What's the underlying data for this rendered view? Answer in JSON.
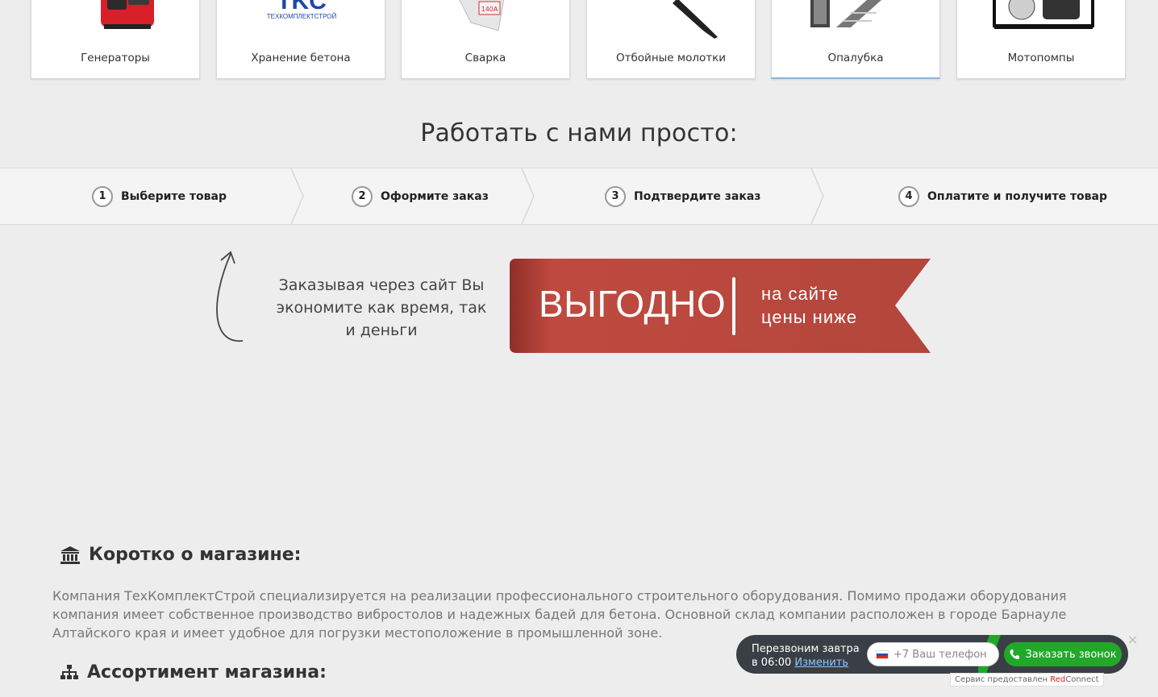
{
  "categories": [
    {
      "label": "Генераторы"
    },
    {
      "label": "Хранение бетона",
      "logo_text": "TKC",
      "logo_sub": "ТЕХКОМПЛЕКТСТРОЙ"
    },
    {
      "label": "Сварка",
      "tag": "140A"
    },
    {
      "label": "Отбойные молотки"
    },
    {
      "label": "Опалубка",
      "active": true
    },
    {
      "label": "Мотопомпы"
    }
  ],
  "headline": "Работать с нами просто:",
  "steps": [
    {
      "num": "1",
      "label": "Выберите товар"
    },
    {
      "num": "2",
      "label": "Оформите заказ"
    },
    {
      "num": "3",
      "label": "Подтвердите заказ"
    },
    {
      "num": "4",
      "label": "Оплатите и получите товар"
    }
  ],
  "promo": {
    "text": "Заказывая через сайт Вы экономите как время, так и деньги",
    "ribbon_big": "ВЫГОДНО",
    "ribbon_line1": "на  сайте",
    "ribbon_line2": "цены  ниже",
    "ribbon_color": "#b5453b"
  },
  "about": {
    "title": "Коротко о магазине:",
    "icon": "bank-icon",
    "text": "Компания ТехКомплектСтрой специализируется на реализации профессионального строительного оборудования. Помимо продажи оборудования компания имеет собственное производство вибростолов и надежных бадей для бетона. Основной склад компании расположен в городе Барнауле Алтайского края и имеет удобное для погрузки местоположение в промышленной зоне."
  },
  "assortment": {
    "title": "Ассортимент магазина:",
    "icon": "sitemap-icon"
  },
  "callback": {
    "line1": "Перезвоним завтра",
    "line2": "в 06:00",
    "change_link": "Изменить",
    "phone_placeholder": "+7 Ваш телефон",
    "button": "Заказать звонок",
    "close": "×",
    "credit_prefix": "Сервис предоставлен ",
    "credit_brand_red": "Red",
    "credit_brand_rest": "Connect",
    "accent": "#21a829"
  }
}
